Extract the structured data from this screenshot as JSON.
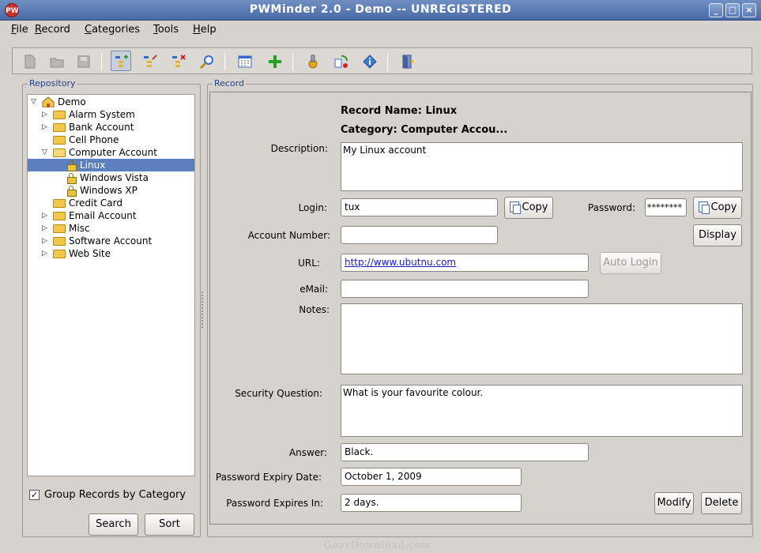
{
  "window": {
    "title": "PWMinder 2.0 - Demo -- UNREGISTERED",
    "app_icon_text": "PW"
  },
  "menu": [
    "File",
    "Record",
    "Categories",
    "Tools",
    "Help"
  ],
  "toolbar": {
    "buttons": [
      {
        "name": "new-file-icon"
      },
      {
        "name": "open-file-icon"
      },
      {
        "name": "save-file-icon"
      },
      {
        "name": "add-record-icon"
      },
      {
        "name": "edit-record-icon"
      },
      {
        "name": "delete-record-icon"
      },
      {
        "name": "search-icon"
      },
      {
        "name": "calendar-grid-icon"
      },
      {
        "name": "add-plus-icon"
      },
      {
        "name": "settings-gear-icon"
      },
      {
        "name": "sync-icon"
      },
      {
        "name": "info-icon"
      },
      {
        "name": "exit-door-icon"
      }
    ]
  },
  "repository": {
    "legend": "Repository",
    "root": "Demo",
    "items": [
      {
        "label": "Alarm System",
        "type": "folder",
        "expandable": true
      },
      {
        "label": "Bank Account",
        "type": "folder",
        "expandable": true
      },
      {
        "label": "Cell Phone",
        "type": "folder",
        "expandable": false
      },
      {
        "label": "Computer Account",
        "type": "folder-open",
        "expandable": true
      },
      {
        "label": "Linux",
        "type": "record",
        "selected": true
      },
      {
        "label": "Windows Vista",
        "type": "record"
      },
      {
        "label": "Windows XP",
        "type": "record"
      },
      {
        "label": "Credit Card",
        "type": "folder",
        "expandable": false
      },
      {
        "label": "Email Account",
        "type": "folder",
        "expandable": true
      },
      {
        "label": "Misc",
        "type": "folder",
        "expandable": true
      },
      {
        "label": "Software Account",
        "type": "folder",
        "expandable": true
      },
      {
        "label": "Web Site",
        "type": "folder",
        "expandable": true
      }
    ],
    "group_checkbox_label": "Group Records by Category",
    "group_checked": true,
    "search_label": "Search",
    "sort_label": "Sort"
  },
  "record": {
    "legend": "Record",
    "record_name": "Record Name: Linux",
    "category": "Category: Computer Accou...",
    "description_label": "Description:",
    "description": "My Linux account",
    "login_label": "Login:",
    "login": "tux",
    "copy_label": "Copy",
    "password_label": "Password:",
    "password": "********",
    "display_label": "Display",
    "account_number_label": "Account Number:",
    "account_number": "",
    "url_label": "URL:",
    "url": "http://www.ubutnu.com",
    "auto_login_label": "Auto Login",
    "email_label": "eMail:",
    "email": "",
    "notes_label": "Notes:",
    "notes": "",
    "security_question_label": "Security Question:",
    "security_question": "What is your favourite colour.",
    "answer_label": "Answer:",
    "answer": "Black.",
    "expiry_date_label": "Password Expiry Date:",
    "expiry_date": "October 1, 2009",
    "expires_in_label": "Password Expires In:",
    "expires_in": "2 days.",
    "modify_label": "Modify",
    "delete_label": "Delete"
  },
  "watermark": "GearDownload.com"
}
